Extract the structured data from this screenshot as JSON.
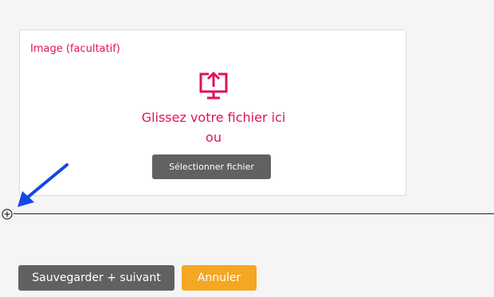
{
  "upload": {
    "label": "Image (facultatif)",
    "drop_line1": "Glissez votre fichier ici",
    "drop_line2": "ou",
    "select_button": "Sélectionner fichier",
    "icon": "upload-monitor-icon"
  },
  "annotation": {
    "arrow_color": "#1546e8",
    "icon": "blue-arrow-pointer"
  },
  "divider": {
    "add_icon": "circle-plus-icon"
  },
  "actions": {
    "save_label": "Sauvegarder + suivant",
    "cancel_label": "Annuler"
  },
  "colors": {
    "accent": "#e0115f",
    "button_gray": "#616161",
    "cancel_orange": "#f5a623",
    "background": "#f5f5f5"
  }
}
